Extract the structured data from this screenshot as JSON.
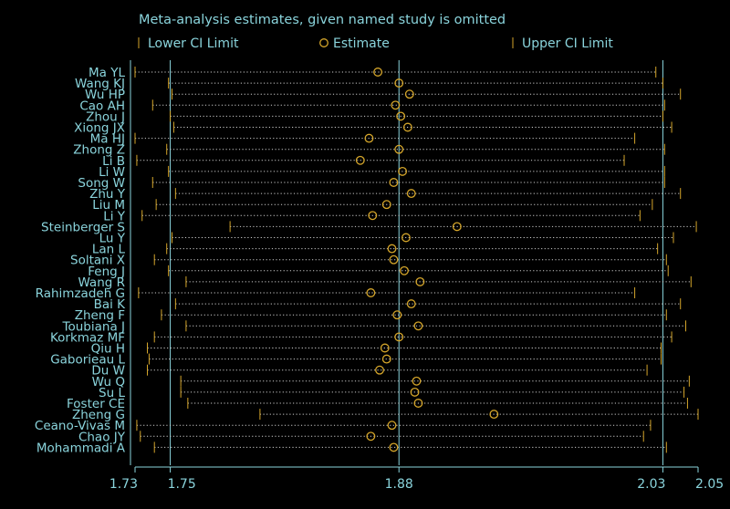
{
  "chart_data": {
    "type": "scatter",
    "title": "Meta-analysis estimates, given named study is omitted",
    "legend": {
      "position": "top",
      "entries": [
        {
          "label": "Lower CI Limit",
          "symbol": "tick"
        },
        {
          "label": "Estimate",
          "symbol": "circle"
        },
        {
          "label": "Upper CI Limit",
          "symbol": "tick"
        }
      ]
    },
    "colors": {
      "background": "#000000",
      "text": "#8ad4dc",
      "axis": "#8ad4dc",
      "reference_line": "#8ad4dc",
      "marker": "#d4a52a",
      "dotted_line": "#cccccc"
    },
    "x_axis": {
      "range": [
        1.73,
        2.05
      ],
      "ticks": [
        {
          "value": 1.73,
          "label": "1.73"
        },
        {
          "value": 1.75,
          "label": "1.75"
        },
        {
          "value": 1.88,
          "label": "1.88"
        },
        {
          "value": 2.03,
          "label": "2.03"
        },
        {
          "value": 2.05,
          "label": "2.05"
        }
      ],
      "reference_lines": [
        1.75,
        1.88,
        2.03
      ]
    },
    "studies": [
      {
        "name": "Ma YL",
        "lower": 1.73,
        "estimate": 1.868,
        "upper": 2.026
      },
      {
        "name": "Wang KJ",
        "lower": 1.749,
        "estimate": 1.88,
        "upper": 2.03
      },
      {
        "name": "Wu HP",
        "lower": 1.751,
        "estimate": 1.886,
        "upper": 2.04
      },
      {
        "name": "Cao AH",
        "lower": 1.74,
        "estimate": 1.878,
        "upper": 2.031
      },
      {
        "name": "Zhou J",
        "lower": 1.75,
        "estimate": 1.881,
        "upper": 2.03
      },
      {
        "name": "Xiong JX",
        "lower": 1.752,
        "estimate": 1.885,
        "upper": 2.035
      },
      {
        "name": "Ma HJ",
        "lower": 1.73,
        "estimate": 1.863,
        "upper": 2.014
      },
      {
        "name": "Zhong Z",
        "lower": 1.748,
        "estimate": 1.88,
        "upper": 2.031
      },
      {
        "name": "Li B",
        "lower": 1.731,
        "estimate": 1.858,
        "upper": 2.008
      },
      {
        "name": "Li W",
        "lower": 1.749,
        "estimate": 1.882,
        "upper": 2.031
      },
      {
        "name": "Song W",
        "lower": 1.74,
        "estimate": 1.877,
        "upper": 2.031
      },
      {
        "name": "Zhu Y",
        "lower": 1.753,
        "estimate": 1.887,
        "upper": 2.04
      },
      {
        "name": "Liu M",
        "lower": 1.742,
        "estimate": 1.873,
        "upper": 2.024
      },
      {
        "name": "Li Y",
        "lower": 1.734,
        "estimate": 1.865,
        "upper": 2.017
      },
      {
        "name": "Steinberger S",
        "lower": 1.784,
        "estimate": 1.913,
        "upper": 2.049
      },
      {
        "name": "Lu Y",
        "lower": 1.751,
        "estimate": 1.884,
        "upper": 2.036
      },
      {
        "name": "Lan L",
        "lower": 1.748,
        "estimate": 1.876,
        "upper": 2.027
      },
      {
        "name": "Soltani X",
        "lower": 1.741,
        "estimate": 1.877,
        "upper": 2.032
      },
      {
        "name": "Feng J",
        "lower": 1.749,
        "estimate": 1.883,
        "upper": 2.033
      },
      {
        "name": "Wang R",
        "lower": 1.759,
        "estimate": 1.892,
        "upper": 2.046
      },
      {
        "name": "Rahimzadeh G",
        "lower": 1.732,
        "estimate": 1.864,
        "upper": 2.014
      },
      {
        "name": "Bai K",
        "lower": 1.753,
        "estimate": 1.887,
        "upper": 2.04
      },
      {
        "name": "Zheng F",
        "lower": 1.745,
        "estimate": 1.879,
        "upper": 2.032
      },
      {
        "name": "Toubiana J",
        "lower": 1.759,
        "estimate": 1.891,
        "upper": 2.043
      },
      {
        "name": "Korkmaz MF",
        "lower": 1.741,
        "estimate": 1.88,
        "upper": 2.035
      },
      {
        "name": "Qiu H",
        "lower": 1.737,
        "estimate": 1.872,
        "upper": 2.029
      },
      {
        "name": "Gaborieau L",
        "lower": 1.738,
        "estimate": 1.873,
        "upper": 2.029
      },
      {
        "name": "Du W",
        "lower": 1.737,
        "estimate": 1.869,
        "upper": 2.021
      },
      {
        "name": "Wu Q",
        "lower": 1.756,
        "estimate": 1.89,
        "upper": 2.045
      },
      {
        "name": "Su L",
        "lower": 1.756,
        "estimate": 1.889,
        "upper": 2.042
      },
      {
        "name": "Foster CE",
        "lower": 1.76,
        "estimate": 1.891,
        "upper": 2.044
      },
      {
        "name": "Zheng G",
        "lower": 1.801,
        "estimate": 1.934,
        "upper": 2.05
      },
      {
        "name": "Ceano-Vivas M",
        "lower": 1.731,
        "estimate": 1.876,
        "upper": 2.023
      },
      {
        "name": "Chao JY",
        "lower": 1.733,
        "estimate": 1.864,
        "upper": 2.019
      },
      {
        "name": "Mohammadi A",
        "lower": 1.741,
        "estimate": 1.877,
        "upper": 2.032
      }
    ]
  }
}
